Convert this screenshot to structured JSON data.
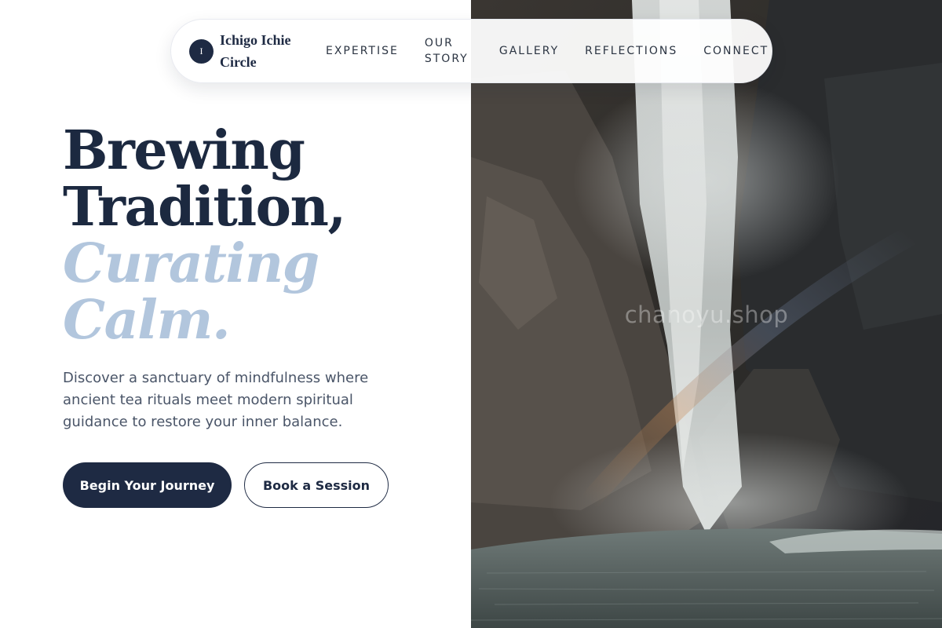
{
  "brand": {
    "mark": "I",
    "name": "Ichigo Ichie Circle"
  },
  "nav": {
    "links": [
      "EXPERTISE",
      "OUR STORY",
      "GALLERY",
      "REFLECTIONS",
      "CONNECT"
    ]
  },
  "hero": {
    "headline_lines": [
      "Brewing",
      "Tradition,"
    ],
    "accent_lines": [
      "Curating",
      "Calm."
    ],
    "description": "Discover a sanctuary of mindfulness where ancient tea rituals meet modern spiritual guidance to restore your inner balance.",
    "primary_cta": "Begin Your Journey",
    "secondary_cta": "Book a Session"
  },
  "image": {
    "subject": "waterfall-photo",
    "watermark": "chanoyu.shop"
  },
  "colors": {
    "navy": "#1e2a43",
    "accent_blue": "#b2c6dd",
    "body_text": "#4a5568"
  }
}
